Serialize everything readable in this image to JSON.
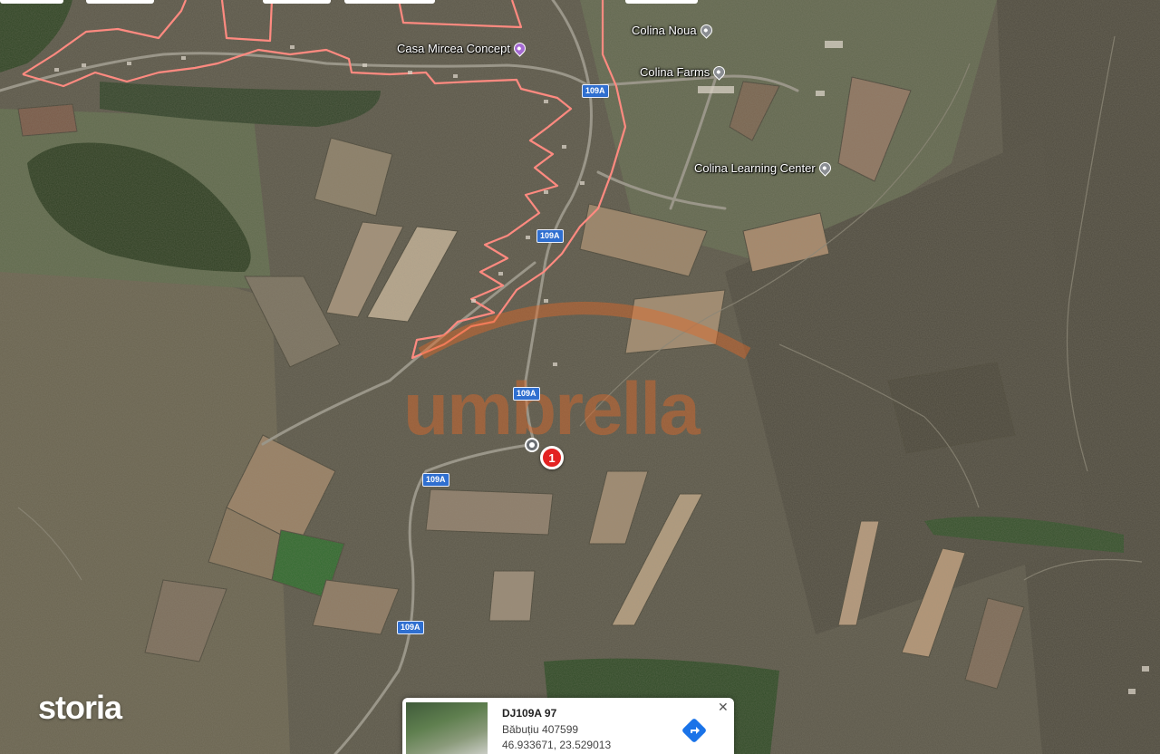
{
  "map": {
    "pois": [
      {
        "name": "Casa Mircea Concept",
        "kind": "shop"
      },
      {
        "name": "Colina Noua",
        "kind": "place"
      },
      {
        "name": "Colina Farms",
        "kind": "place"
      },
      {
        "name": "Colina Learning Center",
        "kind": "place"
      }
    ],
    "road_shields": [
      "109A",
      "109A",
      "109A",
      "109A",
      "109A"
    ],
    "marker_number": "1",
    "watermark": "umbrella",
    "boundary_color": "#ff8a80",
    "marker_color": "#e32222",
    "road_shield_color": "#2f6fd0"
  },
  "brand": {
    "label": "storia"
  },
  "location_card": {
    "title": "DJ109A 97",
    "address": "Băbuțiu 407599",
    "coordinates": "46.933671, 23.529013",
    "directions_icon": "directions-icon",
    "close_label": "✕"
  }
}
